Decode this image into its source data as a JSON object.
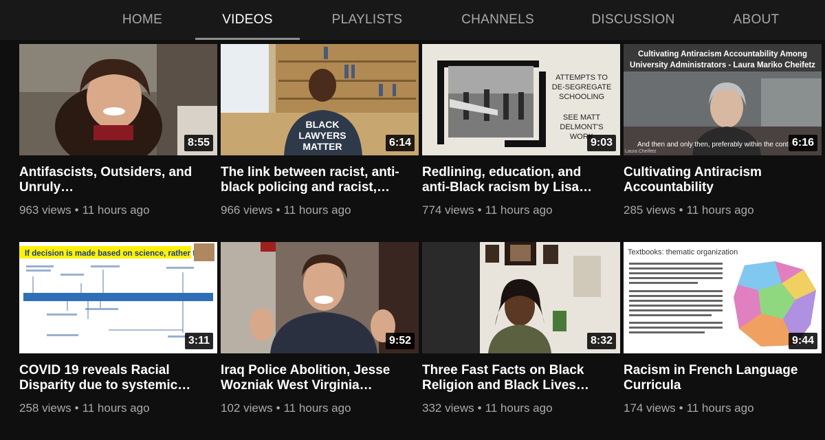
{
  "tabs": [
    "HOME",
    "VIDEOS",
    "PLAYLISTS",
    "CHANNELS",
    "DISCUSSION",
    "ABOUT"
  ],
  "active_tab": "VIDEOS",
  "videos": [
    {
      "title_l1": "Antifascists, Outsiders, and",
      "title_l2": "Unruly…",
      "duration": "8:55",
      "views": "963 views",
      "age": "11 hours ago"
    },
    {
      "title_l1": "The link between racist, anti-",
      "title_l2": "black policing and racist,…",
      "duration": "6:14",
      "views": "966 views",
      "age": "11 hours ago",
      "shirt_text": [
        "BLACK",
        "LAWYERS",
        "MATTER"
      ]
    },
    {
      "title_l1": "Redlining, education, and",
      "title_l2": "anti-Black racism by Lisa…",
      "duration": "9:03",
      "views": "774 views",
      "age": "11 hours ago",
      "slide_text": [
        "ATTEMPTS TO",
        "DE-SEGREGATE",
        "SCHOOLING",
        "SEE MATT",
        "DELMONT'S",
        "WORK"
      ]
    },
    {
      "title_l1": "Cultivating Antiracism",
      "title_l2": "Accountability",
      "duration": "6:16",
      "views": "285 views",
      "age": "11 hours ago",
      "slide_text": [
        "Cultivating Antiracism Accountability Among",
        "University Administrators - Laura Mariko Cheifetz",
        "And then and only then, preferably within the conte",
        "Laura Cheifetz"
      ]
    },
    {
      "title_l1": "COVID 19 reveals Racial",
      "title_l2": "Disparity due to systemic…",
      "duration": "3:11",
      "views": "258 views",
      "age": "11 hours ago",
      "slide_text": [
        "If decision is made based on science, rather than"
      ]
    },
    {
      "title_l1": "Iraq Police Abolition, Jesse",
      "title_l2": "Wozniak West Virginia…",
      "duration": "9:52",
      "views": "102 views",
      "age": "11 hours ago"
    },
    {
      "title_l1": "Three Fast Facts on Black",
      "title_l2": "Religion and Black Lives…",
      "duration": "8:32",
      "views": "332 views",
      "age": "11 hours ago"
    },
    {
      "title_l1": "Racism in French Language",
      "title_l2": "Curricula",
      "duration": "9:44",
      "views": "174 views",
      "age": "11 hours ago",
      "slide_text": [
        "Textbooks: thematic organization"
      ]
    }
  ],
  "meta_sep": "•"
}
